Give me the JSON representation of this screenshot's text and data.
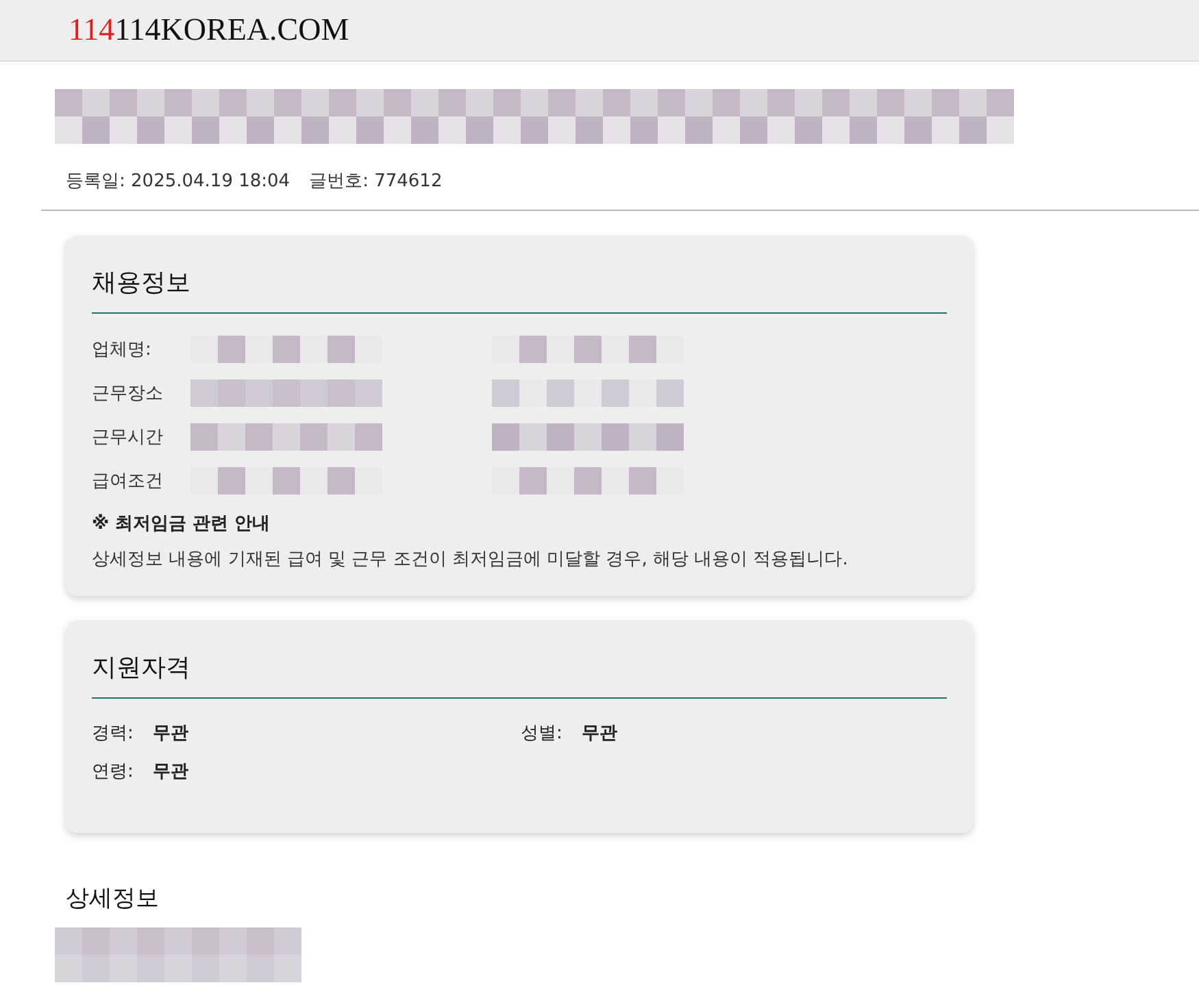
{
  "header": {
    "logo_accent": "114",
    "logo_rest": "114KOREA.COM"
  },
  "meta": {
    "date_label": "등록일:",
    "date": "2025.04.19 18:04",
    "number_label": "글번호:",
    "number": "774612"
  },
  "job_info": {
    "title": "채용정보",
    "rows": [
      {
        "label": "업체명:"
      },
      {
        "label": "근무장소"
      },
      {
        "label": "근무시간"
      },
      {
        "label": "급여조건"
      }
    ],
    "notice_title": "※ 최저임금 관련 안내",
    "notice_text": "상세정보 내용에 기재된 급여 및 근무 조건이 최저임금에 미달할 경우, 해당 내용이 적용됩니다."
  },
  "qualifications": {
    "title": "지원자격",
    "items": [
      {
        "label": "경력:",
        "value": "무관"
      },
      {
        "label": "성별:",
        "value": "무관"
      },
      {
        "label": "연령:",
        "value": "무관"
      }
    ]
  },
  "details": {
    "title": "상세정보"
  }
}
